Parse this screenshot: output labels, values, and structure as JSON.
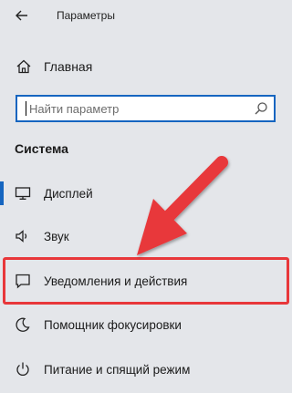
{
  "window": {
    "back_icon": "arrow-left-icon",
    "title": "Параметры"
  },
  "home": {
    "icon": "home-icon",
    "label": "Главная"
  },
  "search": {
    "placeholder": "Найти параметр",
    "value": "",
    "icon": "search-icon"
  },
  "section": {
    "title": "Система"
  },
  "nav": {
    "items": [
      {
        "icon": "display-icon",
        "label": "Дисплей",
        "selected": true
      },
      {
        "icon": "sound-icon",
        "label": "Звук",
        "selected": false
      },
      {
        "icon": "notifications-icon",
        "label": "Уведомления и действия",
        "selected": false,
        "highlighted": true
      },
      {
        "icon": "focus-assist-icon",
        "label": "Помощник фокусировки",
        "selected": false
      },
      {
        "icon": "power-icon",
        "label": "Питание и спящий режим",
        "selected": false
      }
    ]
  },
  "colors": {
    "accent": "#1565c0",
    "annotation_red": "#e8373a",
    "background": "#e4e6ea"
  }
}
